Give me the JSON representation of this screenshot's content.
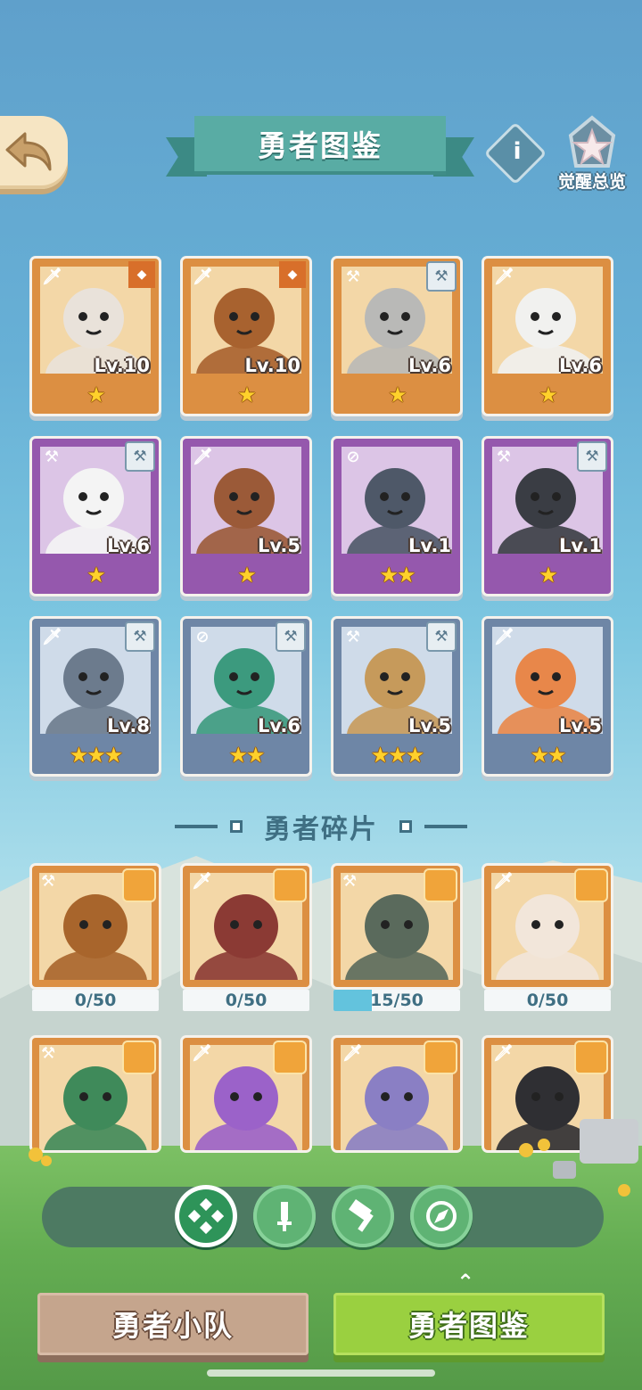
{
  "header": {
    "title": "勇者图鉴",
    "info_label": "i",
    "awaken_label": "觉醒总览"
  },
  "heroes": [
    {
      "level": "Lv.10",
      "stars": "★",
      "rarity": "orange",
      "role": "sword",
      "badge": "shield",
      "color": "#e9e2da"
    },
    {
      "level": "Lv.10",
      "stars": "★",
      "rarity": "orange",
      "role": "sword",
      "badge": "shield",
      "color": "#a8622f"
    },
    {
      "level": "Lv.6",
      "stars": "★",
      "rarity": "orange",
      "role": "hammer",
      "badge": "hammer",
      "color": "#b9b9b7"
    },
    {
      "level": "Lv.6",
      "stars": "★",
      "rarity": "orange",
      "role": "sword",
      "badge": "none",
      "color": "#f1f1ef"
    },
    {
      "level": "Lv.6",
      "stars": "★",
      "rarity": "purple",
      "role": "hammer",
      "badge": "hammer",
      "color": "#f4f4f4"
    },
    {
      "level": "Lv.5",
      "stars": "★",
      "rarity": "purple",
      "role": "sword",
      "badge": "none",
      "color": "#9b5a38"
    },
    {
      "level": "Lv.1",
      "stars": "★★",
      "rarity": "purple",
      "role": "compass",
      "badge": "none",
      "color": "#4e5868"
    },
    {
      "level": "Lv.1",
      "stars": "★",
      "rarity": "purple",
      "role": "hammer",
      "badge": "hammer",
      "color": "#3a3d44"
    },
    {
      "level": "Lv.8",
      "stars": "★★★",
      "rarity": "blue",
      "role": "sword",
      "badge": "hammer",
      "color": "#6c7b8d"
    },
    {
      "level": "Lv.6",
      "stars": "★★",
      "rarity": "blue",
      "role": "compass",
      "badge": "hammer",
      "color": "#3c9a7e"
    },
    {
      "level": "Lv.5",
      "stars": "★★★",
      "rarity": "blue",
      "role": "hammer",
      "badge": "hammer",
      "color": "#c69a5b"
    },
    {
      "level": "Lv.5",
      "stars": "★★",
      "rarity": "blue",
      "role": "sword",
      "badge": "none",
      "color": "#e8874a"
    }
  ],
  "shards_title": "勇者碎片",
  "shards": [
    {
      "progress_text": "0/50",
      "fraction": 0.0,
      "role": "hammer",
      "color": "#a8652c"
    },
    {
      "progress_text": "0/50",
      "fraction": 0.0,
      "role": "sword",
      "color": "#8b3a34"
    },
    {
      "progress_text": "15/50",
      "fraction": 0.3,
      "role": "hammer",
      "color": "#5a6a5c"
    },
    {
      "progress_text": "0/50",
      "fraction": 0.0,
      "role": "sword",
      "color": "#f2e6da"
    },
    {
      "progress_text": "",
      "fraction": 0.0,
      "role": "hammer",
      "color": "#3f8a5a"
    },
    {
      "progress_text": "",
      "fraction": 0.0,
      "role": "sword",
      "color": "#9b62c9"
    },
    {
      "progress_text": "",
      "fraction": 0.0,
      "role": "sword",
      "color": "#8a7fc4"
    },
    {
      "progress_text": "",
      "fraction": 0.0,
      "role": "sword",
      "color": "#2f2f33"
    }
  ],
  "filters": [
    "all-icon",
    "sword-icon",
    "hammer-icon",
    "compass-icon"
  ],
  "bottom": {
    "team_label": "勇者小队",
    "codex_label": "勇者图鉴",
    "caret": "⌃"
  }
}
